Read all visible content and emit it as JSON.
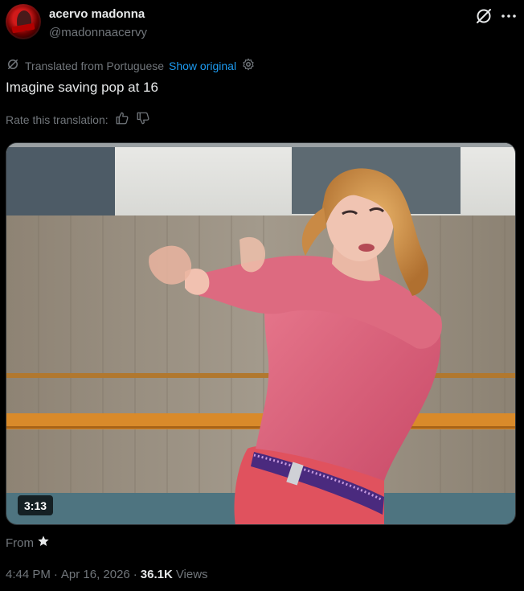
{
  "author": {
    "display_name": "acervo madonna",
    "handle": "@madonnaacervy"
  },
  "header_icons": {
    "grok": "grok-icon",
    "more": "more-icon"
  },
  "translation": {
    "notice": "Translated from Portuguese",
    "show_original": "Show original",
    "settings_icon": "gear-icon",
    "rate_label": "Rate this translation:",
    "thumbs_up_icon": "thumbs-up-icon",
    "thumbs_down_icon": "thumbs-down-icon"
  },
  "post": {
    "text": "Imagine saving pop at 16"
  },
  "media": {
    "type": "video",
    "duration": "3:13"
  },
  "source": {
    "label": "From",
    "icon": "star-icon"
  },
  "meta": {
    "time": "4:44 PM",
    "date": "Apr 16, 2026",
    "views_count": "36.1K",
    "views_label": "Views",
    "separator": "·"
  },
  "colors": {
    "background": "#000000",
    "text": "#e7e9ea",
    "secondary": "#71767b",
    "link": "#1d9bf0"
  }
}
